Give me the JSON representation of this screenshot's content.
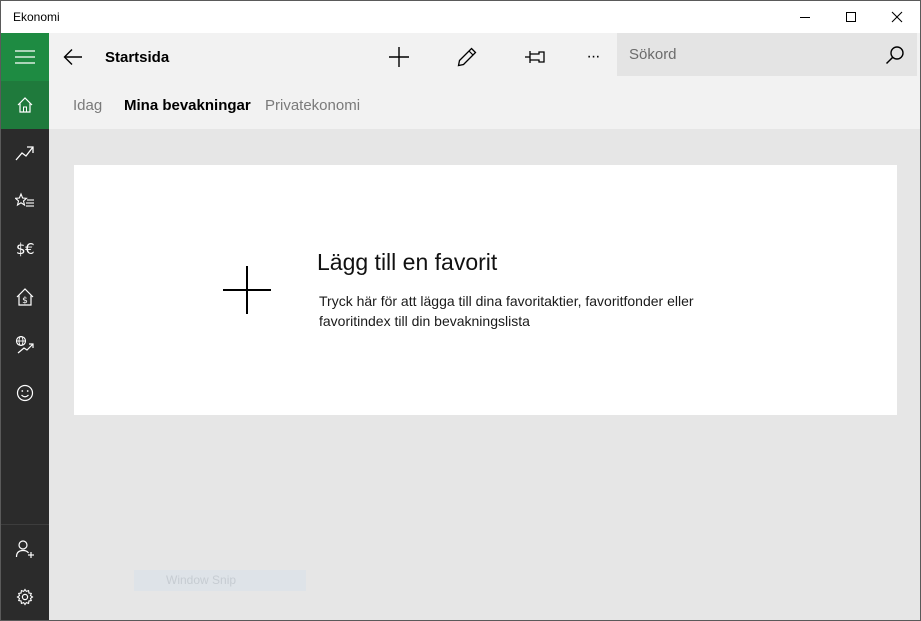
{
  "window": {
    "title": "Ekonomi",
    "controls": [
      "minimize-icon",
      "maximize-icon",
      "close-icon"
    ]
  },
  "sidebar": {
    "accent_color": "#1e8b42",
    "items": [
      {
        "name": "hamburger-menu",
        "icon": "hamburger-icon",
        "selected": false
      },
      {
        "name": "home",
        "icon": "home-icon",
        "selected": true
      },
      {
        "name": "markets",
        "icon": "trend-up-icon",
        "selected": false
      },
      {
        "name": "watchlist",
        "icon": "star-list-icon",
        "selected": false
      },
      {
        "name": "currencies",
        "icon": "currency-icon",
        "glyph": "$€",
        "selected": false
      },
      {
        "name": "mortgage",
        "icon": "house-dollar-icon",
        "selected": false
      },
      {
        "name": "world-markets",
        "icon": "globe-trend-icon",
        "selected": false
      }
    ],
    "feedback_icon": "smiley-icon",
    "bottom_items": [
      {
        "name": "account",
        "icon": "person-add-icon"
      },
      {
        "name": "settings",
        "icon": "gear-icon"
      }
    ]
  },
  "header": {
    "back_icon": "back-arrow-icon",
    "title": "Startsida",
    "toolbar": [
      "add-icon",
      "pencil-icon",
      "pin-icon",
      "more-icon"
    ],
    "more_glyph": "···",
    "search": {
      "placeholder": "Sökord",
      "value": "",
      "icon": "search-icon"
    }
  },
  "tabs": [
    {
      "label": "Idag",
      "selected": false
    },
    {
      "label": "Mina bevakningar",
      "selected": true
    },
    {
      "label": "Privatekonomi",
      "selected": false
    }
  ],
  "main": {
    "add_card": {
      "icon": "large-plus-icon",
      "title": "Lägg till en favorit",
      "description": "Tryck här för att lägga till dina favoritaktier, favoritfonder eller favoritindex till din bevakningslista"
    }
  },
  "overlay": {
    "snip_label": "Window Snip"
  }
}
